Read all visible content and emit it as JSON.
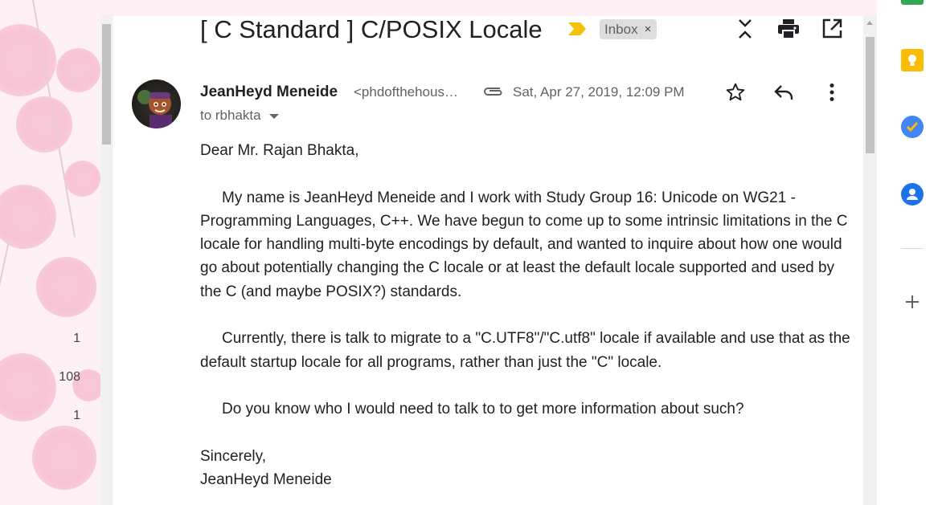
{
  "email": {
    "subject": "[ C Standard ] C/POSIX Locale",
    "label": "Inbox",
    "label_remove": "×",
    "sender_name": "JeanHeyd Meneide",
    "sender_email": "<phdofthehous…",
    "date": "Sat, Apr 27, 2019, 12:09 PM",
    "to": "to rbhakta",
    "greeting": "Dear Mr. Rajan Bhakta,",
    "paragraph1": "My name is JeanHeyd Meneide and I work with Study Group 16: Unicode on WG21 - Programming Languages, C++. We have begun to come up to some intrinsic limitations in the C locale for handling multi-byte encodings by default, and wanted to inquire about how one would go about potentially changing the C locale or at least the default locale supported and used by the C (and maybe POSIX?) standards.",
    "paragraph2": "Currently, there is talk to migrate to a \"C.UTF8\"/\"C.utf8\" locale if available and use that as the default startup locale for all programs, rather than just the \"C\" locale.",
    "paragraph3": "Do you know who I would need to talk to to get more information about such?",
    "closing": "Sincerely,",
    "signature": "JeanHeyd Meneide"
  },
  "gutter_counts": [
    "1",
    "108",
    "1"
  ],
  "icons": {
    "importance": "importance-marker-icon",
    "collapse": "collapse-all-icon",
    "print": "print-icon",
    "new_window": "open-in-new-window-icon",
    "attachment": "attachment-icon",
    "star": "star-icon",
    "reply": "reply-icon",
    "more": "more-vert-icon",
    "keep": "keep-icon",
    "tasks": "tasks-icon",
    "contacts": "contacts-icon",
    "add": "add-icon"
  },
  "colors": {
    "importance": "#f4c20d",
    "keep": "#fbbc04",
    "tasks": "#4285f4",
    "contacts": "#1a73e8",
    "background": "#fdf1f5"
  }
}
